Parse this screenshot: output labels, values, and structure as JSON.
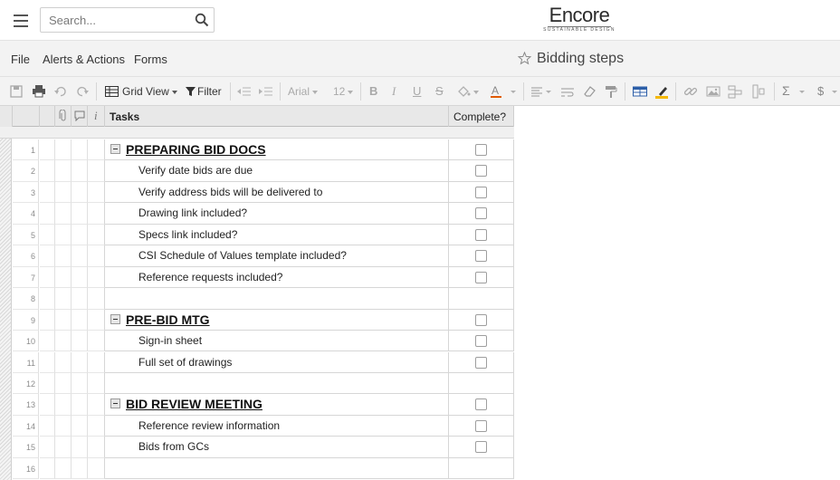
{
  "app": {
    "search_placeholder": "Search...",
    "logo": {
      "word": "Encore",
      "tagline": "SUSTAINABLE DESIGN"
    }
  },
  "menu": {
    "items": [
      "File",
      "Alerts & Actions",
      "Forms"
    ],
    "sheet_title": "Bidding steps"
  },
  "toolbar": {
    "view_label": "Grid View",
    "filter_label": "Filter",
    "font_family": "Arial",
    "font_size": "12",
    "icons": [
      "save-icon",
      "print-icon",
      "undo-icon",
      "redo-icon",
      "grid-view-icon",
      "filter-icon",
      "outdent-icon",
      "indent-icon",
      "bold-icon",
      "italic-icon",
      "underline-icon",
      "strikethrough-icon",
      "fill-color-icon",
      "text-color-icon",
      "align-icon",
      "wrap-icon",
      "clear-format-icon",
      "format-painter-icon",
      "conditional-format-icon",
      "highlight-icon",
      "link-icon",
      "image-icon",
      "hierarchy-icon",
      "column-icon",
      "sum-icon",
      "currency-icon"
    ]
  },
  "grid": {
    "columns": {
      "tasks": "Tasks",
      "complete": "Complete?"
    },
    "rows": [
      {
        "num": "1",
        "type": "parent",
        "task": "PREPARING BID DOCS",
        "checkbox": true
      },
      {
        "num": "2",
        "type": "child",
        "task": "Verify date bids are due",
        "checkbox": true
      },
      {
        "num": "3",
        "type": "child",
        "task": "Verify address bids will be delivered to",
        "checkbox": true
      },
      {
        "num": "4",
        "type": "child",
        "task": "Drawing link included?",
        "checkbox": true
      },
      {
        "num": "5",
        "type": "child",
        "task": "Specs link included?",
        "checkbox": true
      },
      {
        "num": "6",
        "type": "child",
        "task": "CSI Schedule of Values template included?",
        "checkbox": true
      },
      {
        "num": "7",
        "type": "child",
        "task": "Reference requests included?",
        "checkbox": true
      },
      {
        "num": "8",
        "type": "empty",
        "task": "",
        "checkbox": false
      },
      {
        "num": "9",
        "type": "parent",
        "task": "PRE-BID MTG",
        "checkbox": true
      },
      {
        "num": "10",
        "type": "child",
        "task": "Sign-in sheet",
        "checkbox": true
      },
      {
        "num": "11",
        "type": "child",
        "task": "Full set of drawings",
        "checkbox": true
      },
      {
        "num": "12",
        "type": "empty",
        "task": "",
        "checkbox": false
      },
      {
        "num": "13",
        "type": "parent",
        "task": "BID REVIEW MEETING",
        "checkbox": true
      },
      {
        "num": "14",
        "type": "child",
        "task": "Reference review information",
        "checkbox": true
      },
      {
        "num": "15",
        "type": "child",
        "task": "Bids from GCs",
        "checkbox": true
      },
      {
        "num": "16",
        "type": "empty",
        "task": "",
        "checkbox": false
      }
    ]
  },
  "colors": {
    "accent_highlight": "#f5b800",
    "text_color_bar": "#e05a00",
    "grid_header": "#e8e8e8"
  }
}
